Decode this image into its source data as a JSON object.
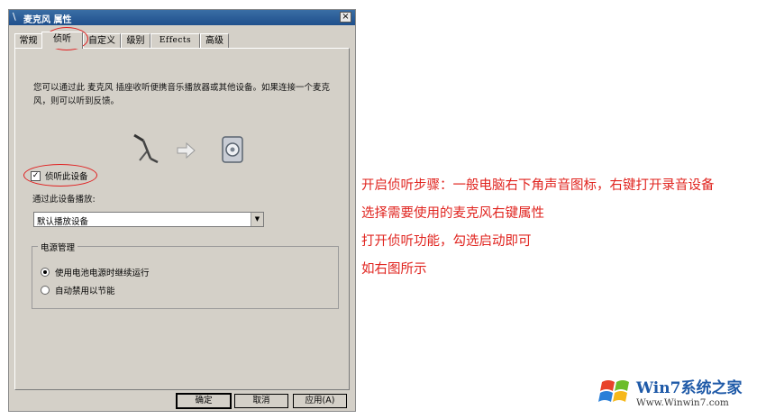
{
  "window": {
    "title": "麦克风 属性",
    "close_glyph": "×"
  },
  "tabs": [
    {
      "label": "常规"
    },
    {
      "label": "侦听"
    },
    {
      "label": "自定义"
    },
    {
      "label": "级别"
    },
    {
      "label": "Effects"
    },
    {
      "label": "高级"
    }
  ],
  "active_tab": "侦听",
  "listen": {
    "description": "您可以通过此 麦克风 插座收听便携音乐播放器或其他设备。如果连接一个麦克风，则可以听到反馈。",
    "checkbox_label": "侦听此设备",
    "checkbox_checked": true,
    "playback_label": "通过此设备播放:",
    "playback_device": "默认播放设备"
  },
  "power": {
    "group_label": "电源管理",
    "options": [
      {
        "label": "使用电池电源时继续运行",
        "selected": true
      },
      {
        "label": "自动禁用以节能",
        "selected": false
      }
    ]
  },
  "buttons": {
    "ok": "确定",
    "cancel": "取消",
    "apply": "应用(A)"
  },
  "instructions": [
    "开启侦听步骤：一般电脑右下角声音图标，右键打开录音设备",
    "选择需要使用的麦克风右键属性",
    "打开侦听功能，勾选启动即可",
    "如右图所示"
  ],
  "watermark": {
    "brand": "Win7系统之家",
    "url": "Www.Winwin7.com"
  },
  "colors": {
    "instruction_text": "#e0241f",
    "highlight_ring": "#e02020",
    "dialog_face": "#d4d0c8",
    "brand_blue": "#1f5aa8"
  }
}
